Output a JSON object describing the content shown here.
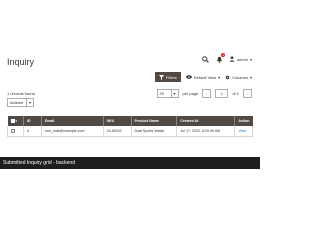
{
  "header": {
    "title": "Inquiry",
    "notification_count": "1",
    "user_name": "admin"
  },
  "toolbar": {
    "filters_label": "Filters",
    "view_label": "Default View",
    "columns_label": "Columns"
  },
  "grid_meta": {
    "records_found": "1 records found",
    "actions_label": "Actions",
    "page_size": "20",
    "per_page_label": "per page",
    "current_page": "1",
    "total_pages": "of 1"
  },
  "table": {
    "columns": [
      "ID",
      "Email",
      "SKU",
      "Product Name",
      "Created At",
      "Action"
    ],
    "rows": [
      {
        "id": "4",
        "email": "roni_cost@example.com",
        "sku": "24-MG02",
        "product_name": "Dual Sports Watch",
        "created_at": "Jul 17, 2022, 6:20:49 AM",
        "action": "View"
      }
    ]
  },
  "caption": "Submitted Inquiry grid - backend",
  "colors": {
    "header_bg": "#514943",
    "accent_link": "#007bdb",
    "notification": "#e22626",
    "caption_bg": "#1e1e1e"
  },
  "icons": [
    "search-icon",
    "bell-icon",
    "user-icon",
    "filter-icon",
    "eye-icon",
    "gear-icon",
    "chevron-down-icon",
    "chevron-left-icon",
    "chevron-right-icon"
  ]
}
